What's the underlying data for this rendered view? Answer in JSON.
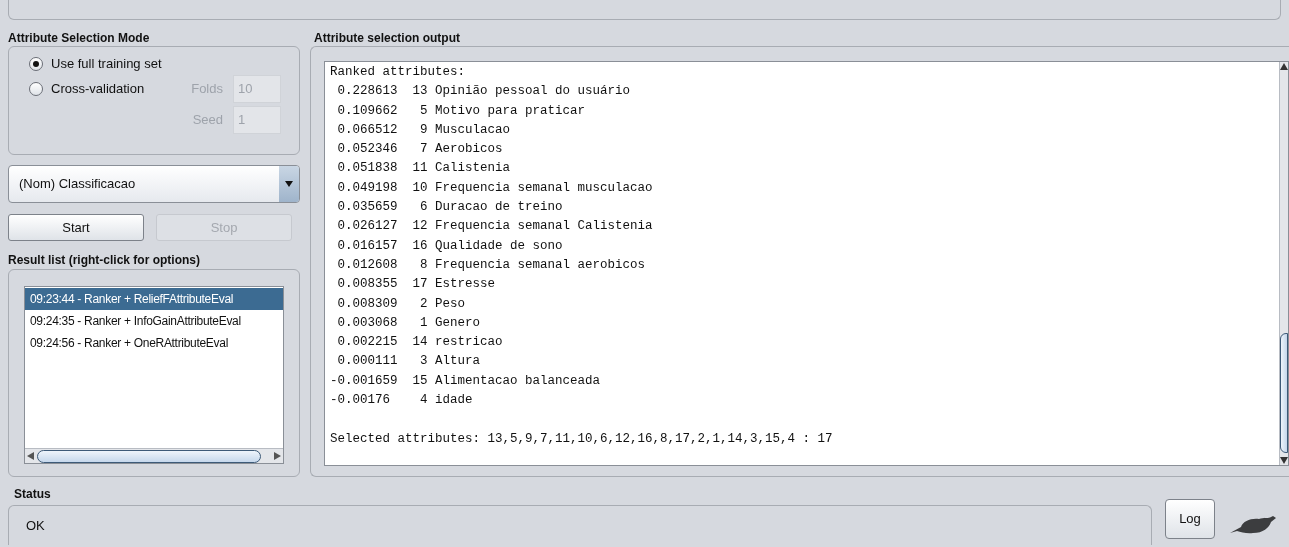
{
  "mode_panel": {
    "title": "Attribute Selection Mode",
    "options": [
      {
        "label": "Use full training set",
        "selected": true
      },
      {
        "label": "Cross-validation",
        "selected": false
      }
    ],
    "fields": [
      {
        "label": "Folds",
        "value": "10",
        "disabled": true
      },
      {
        "label": "Seed",
        "value": "1",
        "disabled": true
      }
    ]
  },
  "class_select": {
    "value": "(Nom) Classificacao"
  },
  "buttons": [
    {
      "label": "Start",
      "disabled": false
    },
    {
      "label": "Stop",
      "disabled": true
    }
  ],
  "result_list": {
    "title": "Result list (right-click for options)",
    "items": [
      {
        "label": "09:23:44 - Ranker + ReliefFAttributeEval",
        "selected": true
      },
      {
        "label": "09:24:35 - Ranker + InfoGainAttributeEval",
        "selected": false
      },
      {
        "label": "09:24:56 - Ranker + OneRAttributeEval",
        "selected": false
      }
    ]
  },
  "output": {
    "title": "Attribute selection output",
    "lines": [
      "Ranked attributes:",
      " 0.228613  13 Opinião pessoal do usuário",
      " 0.109662   5 Motivo para praticar",
      " 0.066512   9 Musculacao",
      " 0.052346   7 Aerobicos",
      " 0.051838  11 Calistenia",
      " 0.049198  10 Frequencia semanal musculacao",
      " 0.035659   6 Duracao de treino",
      " 0.026127  12 Frequencia semanal Calistenia",
      " 0.016157  16 Qualidade de sono",
      " 0.012608   8 Frequencia semanal aerobicos",
      " 0.008355  17 Estresse",
      " 0.008309   2 Peso",
      " 0.003068   1 Genero",
      " 0.002215  14 restricao",
      " 0.000111   3 Altura",
      "-0.001659  15 Alimentacao balanceada",
      "-0.00176    4 idade"
    ],
    "summary": "Selected attributes: 13,5,9,7,11,10,6,12,16,8,17,2,1,14,3,15,4 : 17"
  },
  "status": {
    "title": "Status",
    "text": "OK",
    "log_button": "Log"
  }
}
